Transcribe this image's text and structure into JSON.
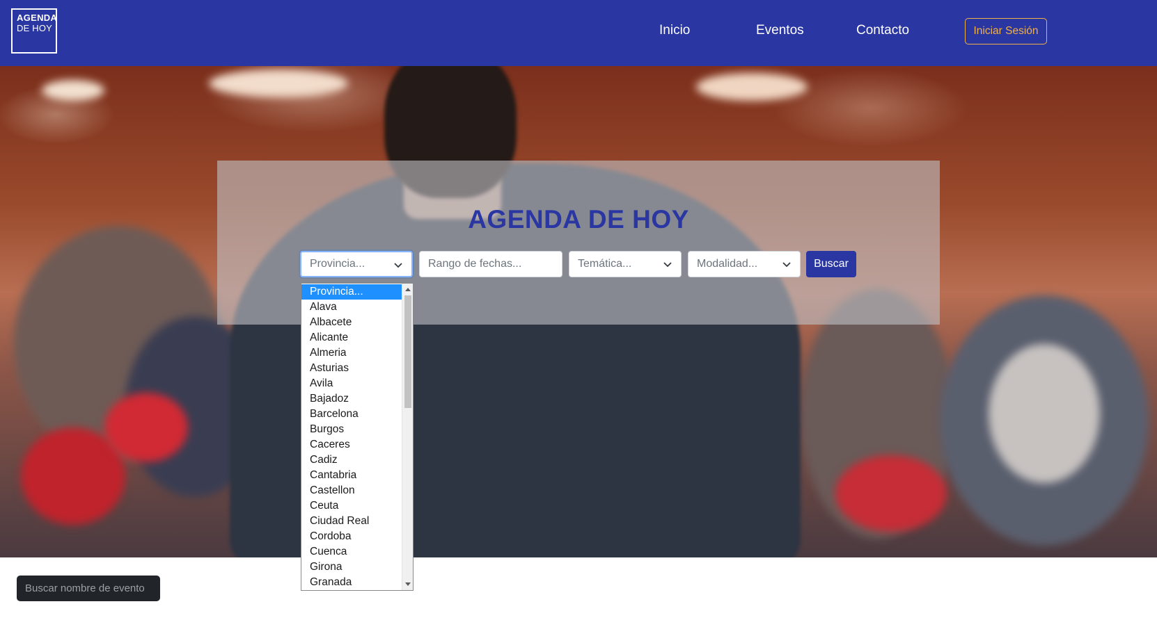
{
  "navbar": {
    "logo_line1": "AGENDA",
    "logo_line2": "DE HOY",
    "links": [
      "Inicio",
      "Eventos",
      "Contacto"
    ],
    "login_label": "Iniciar Sesión"
  },
  "hero": {
    "title": "AGENDA DE HOY",
    "filters": {
      "provincia_placeholder": "Provincia...",
      "fechas_placeholder": "Rango de fechas...",
      "tematica_placeholder": "Temática...",
      "modalidad_placeholder": "Modalidad..."
    },
    "search_button": "Buscar"
  },
  "provincia_dropdown": {
    "selected": "Provincia...",
    "options": [
      "Provincia...",
      "Alava",
      "Albacete",
      "Alicante",
      "Almeria",
      "Asturias",
      "Avila",
      "Bajadoz",
      "Barcelona",
      "Burgos",
      "Caceres",
      "Cadiz",
      "Cantabria",
      "Castellon",
      "Ceuta",
      "Ciudad Real",
      "Cordoba",
      "Cuenca",
      "Girona",
      "Granada"
    ]
  },
  "event_search": {
    "placeholder": "Buscar nombre de evento"
  },
  "colors": {
    "brand_blue": "#2a36a1",
    "login_accent": "#f0b04c",
    "selected_option": "#1e90ff"
  },
  "icons": {
    "select_chevron": "chevron-down-icon",
    "scroll_up": "scroll-up-arrow-icon",
    "scroll_down": "scroll-down-arrow-icon"
  }
}
